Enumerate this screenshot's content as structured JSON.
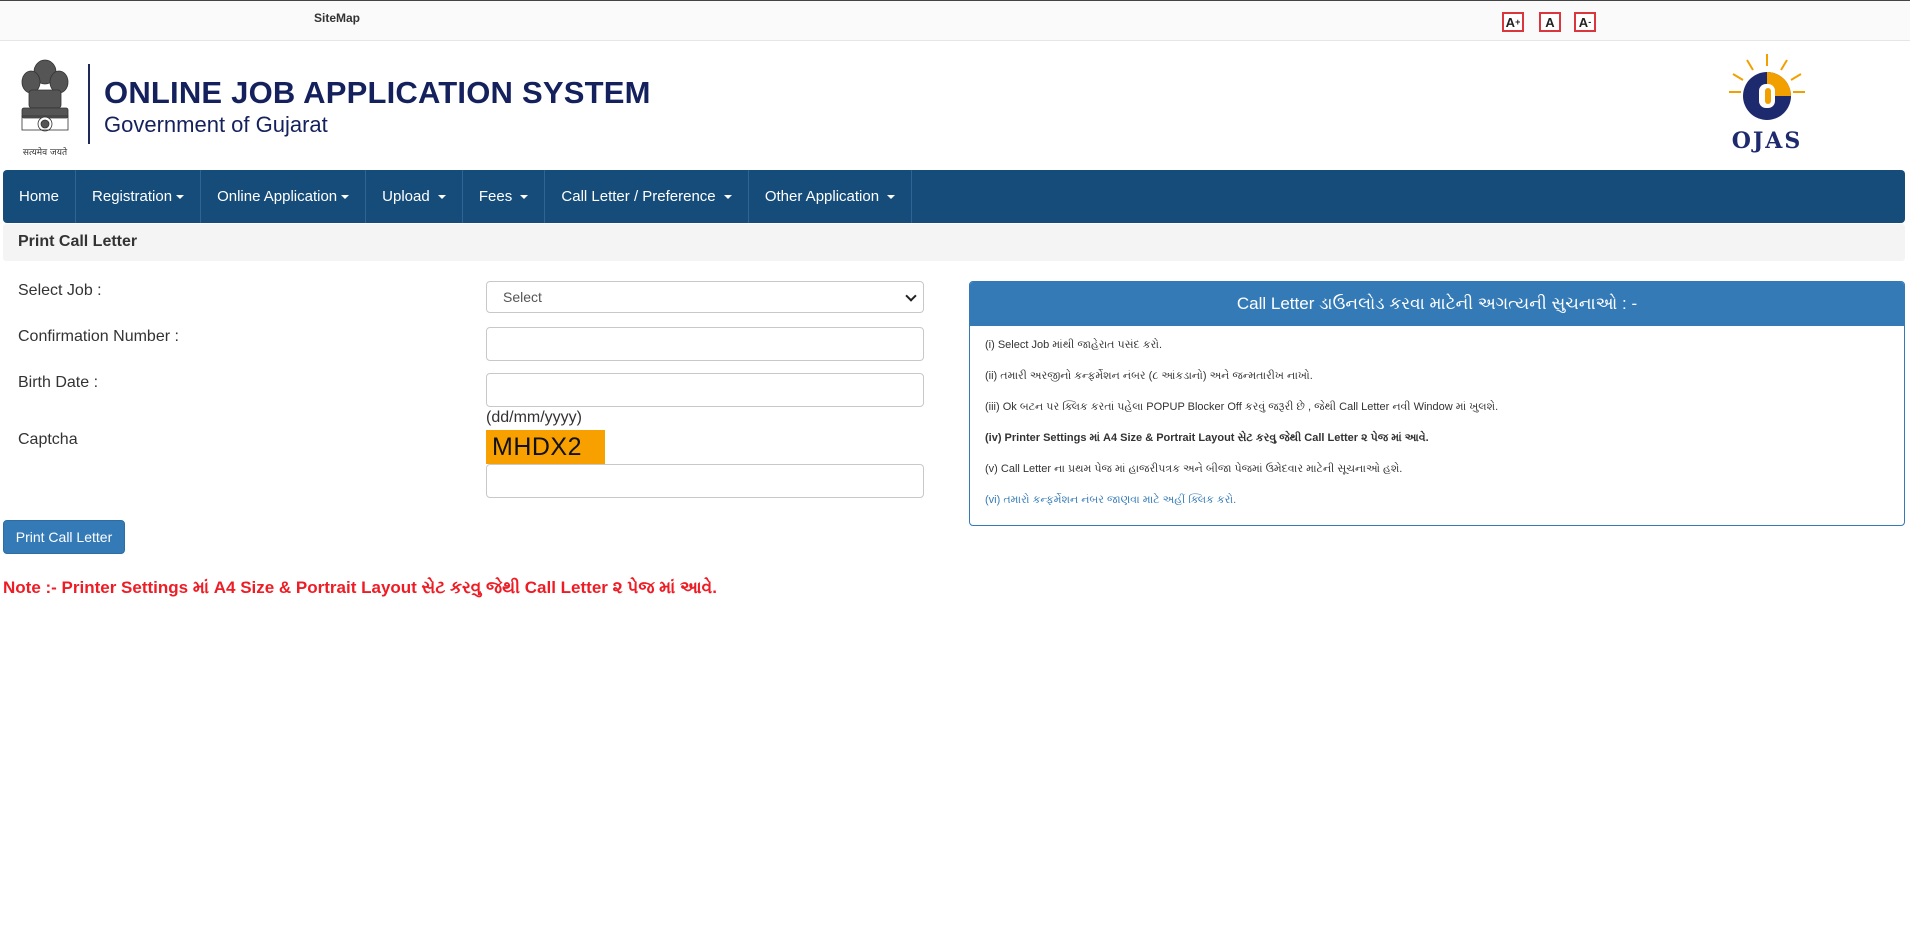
{
  "topbar": {
    "sitemap": "SiteMap",
    "font_increase": "A",
    "font_increase_sup": "+",
    "font_normal": "A",
    "font_decrease": "A",
    "font_decrease_sup": "-"
  },
  "header": {
    "title": "ONLINE JOB APPLICATION SYSTEM",
    "subtitle": "Government of Gujarat",
    "emblem_motto": "सत्यमेव जयते",
    "logo_text": "OJAS"
  },
  "nav": {
    "items": [
      {
        "label": "Home",
        "dropdown": false
      },
      {
        "label": "Registration",
        "dropdown": true
      },
      {
        "label": "Online Application",
        "dropdown": true
      },
      {
        "label": "Upload",
        "dropdown": true
      },
      {
        "label": "Fees",
        "dropdown": true
      },
      {
        "label": "Call Letter / Preference",
        "dropdown": true
      },
      {
        "label": "Other Application",
        "dropdown": true
      }
    ]
  },
  "page": {
    "title": "Print Call Letter"
  },
  "form": {
    "select_job_label": "Select Job :",
    "select_job_value": "Select",
    "confirmation_label": "Confirmation Number :",
    "confirmation_value": "",
    "birthdate_label": "Birth Date :",
    "birthdate_value": "",
    "birthdate_hint": "(dd/mm/yyyy)",
    "captcha_label": "Captcha",
    "captcha_text": "MHDX2",
    "captcha_value": "",
    "submit_label": "Print Call Letter"
  },
  "instructions": {
    "heading": "Call Letter ડાઉનલોડ કરવા માટેની અગત્યની સુચનાઓ : -",
    "items": [
      "(i) Select Job માંથી જાહેરાત પસંદ કરો.",
      "(ii) તમારી અરજીનો કન્ફર્મેશન નંબર (૮ આંકડાનો) અને જન્મતારીખ નાખો.",
      "(iii) Ok બટન પર ક્લિક કરતાં પહેલા POPUP Blocker Off કરવું જરૂરી છે , જેથી Call Letter નવી Window માં ખુલશે.",
      "(iv) Printer Settings માં A4 Size & Portrait Layout સેટ કરવુ જેથી Call Letter ૨ પેજ માં આવે.",
      "(v) Call Letter ના પ્રથમ પેજ માં હાજરીપત્રક અને બીજા પેજમાં ઉમેદવાર માટેની સૂચનાઓ હશે.",
      "(vi) તમારો કન્ફર્મેશન નંબર જાણવા માટે અહીં ક્લિક કરો."
    ]
  },
  "note": "Note :- Printer Settings માં A4 Size & Portrait Layout સેટ કરવુ જેથી Call Letter ૨ પેજ માં આવે.",
  "colors": {
    "nav_bg": "#154c79",
    "panel_blue": "#337ab7",
    "captcha_bg": "#f8a000",
    "note_red": "#ee1c24",
    "title_navy": "#14215c"
  }
}
